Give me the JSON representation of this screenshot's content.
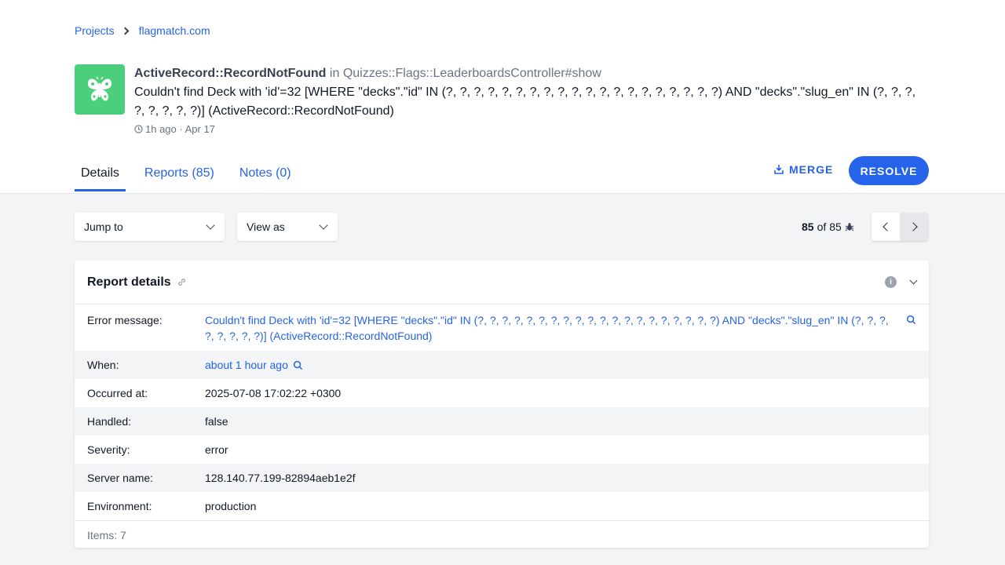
{
  "breadcrumb": {
    "projects": "Projects",
    "project": "flagmatch.com"
  },
  "error": {
    "class": "ActiveRecord::RecordNotFound",
    "in": "in",
    "controller": "Quizzes::Flags::LeaderboardsController#show",
    "message": "Couldn't find Deck with 'id'=32 [WHERE \"decks\".\"id\" IN (?, ?, ?, ?, ?, ?, ?, ?, ?, ?, ?, ?, ?, ?, ?, ?, ?, ?, ?, ?) AND \"decks\".\"slug_en\" IN (?, ?, ?, ?, ?, ?, ?, ?)] (ActiveRecord::RecordNotFound)",
    "time": "1h ago · Apr 17"
  },
  "tabs": [
    {
      "label": "Details"
    },
    {
      "label": "Reports (85)"
    },
    {
      "label": "Notes (0)"
    }
  ],
  "actions": {
    "merge": "MERGE",
    "resolve": "RESOLVE"
  },
  "toolbar": {
    "jump_to": "Jump to",
    "view_as": "View as",
    "current": "85",
    "of": "of",
    "total": "85"
  },
  "report": {
    "title": "Report details",
    "rows": [
      {
        "label": "Error message:",
        "value": "Couldn't find Deck with 'id'=32 [WHERE \"decks\".\"id\" IN (?, ?, ?, ?, ?, ?, ?, ?, ?, ?, ?, ?, ?, ?, ?, ?, ?, ?, ?, ?) AND \"decks\".\"slug_en\" IN (?, ?, ?, ?, ?, ?, ?, ?)] (ActiveRecord::RecordNotFound)"
      },
      {
        "label": "When:",
        "value": "about 1 hour ago"
      },
      {
        "label": "Occurred at:",
        "value": "2025-07-08 17:02:22 +0300"
      },
      {
        "label": "Handled:",
        "value": "false"
      },
      {
        "label": "Severity:",
        "value": "error"
      },
      {
        "label": "Server name:",
        "value": "128.140.77.199-82894aeb1e2f"
      },
      {
        "label": "Environment:",
        "value": "production"
      }
    ],
    "footer": "Items: 7"
  },
  "icons": {
    "app": "butterfly-icon",
    "clock": "clock-icon",
    "merge": "merge-icon",
    "bug": "bug-icon",
    "info": "info-icon",
    "search": "search-icon",
    "link": "link-icon"
  }
}
